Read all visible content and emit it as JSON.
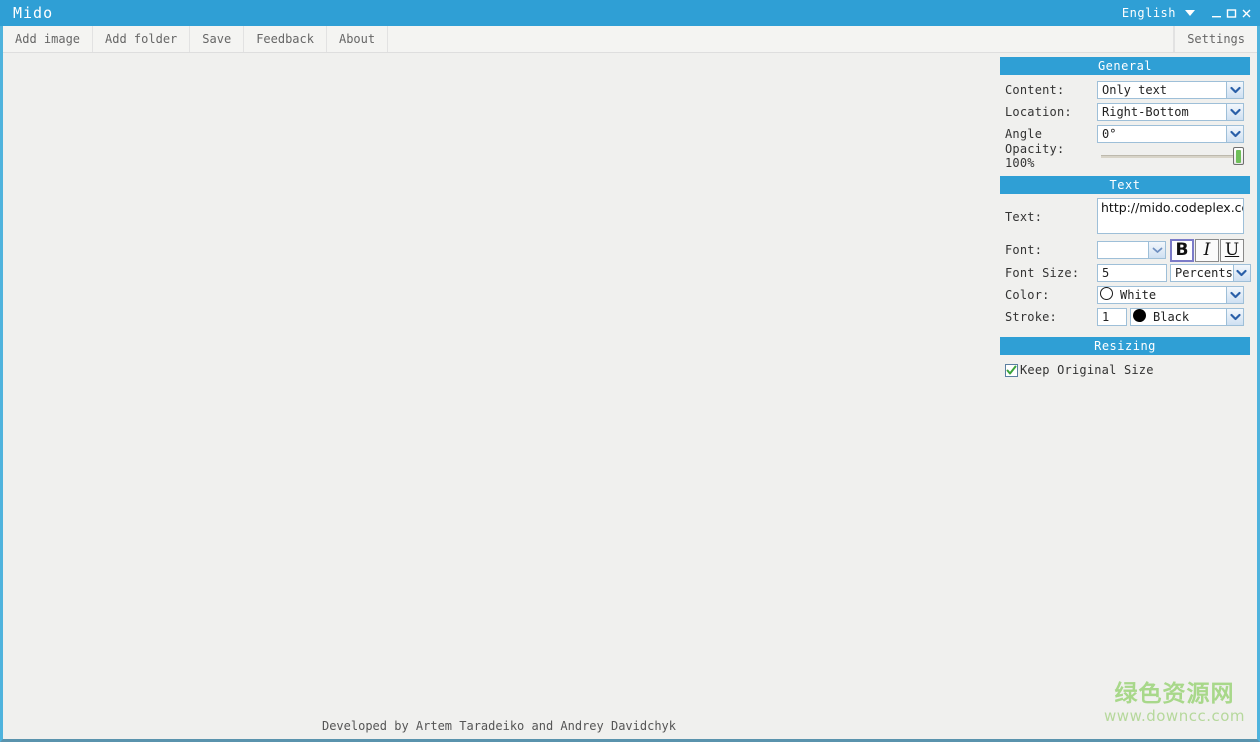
{
  "window": {
    "title": "Mido",
    "language": "English",
    "controls": {
      "minimize": "minimize-button",
      "maximize": "maximize-button",
      "close": "close-button"
    }
  },
  "menubar": {
    "items": [
      {
        "label": "Add image"
      },
      {
        "label": "Add folder"
      },
      {
        "label": "Save"
      },
      {
        "label": "Feedback"
      },
      {
        "label": "About"
      }
    ],
    "settings_label": "Settings"
  },
  "canvas": {
    "credit": "Developed by Artem Taradeiko and Andrey Davidchyk",
    "watermark_cn": "绿色资源网",
    "watermark_en": "www.downcc.com"
  },
  "panels": {
    "general": {
      "header": "General",
      "content_label": "Content:",
      "content_value": "Only text",
      "location_label": "Location:",
      "location_value": "Right-Bottom",
      "angle_label": "Angle",
      "angle_value": "0°",
      "opacity_label": "Opacity: 100%"
    },
    "text": {
      "header": "Text",
      "text_label": "Text:",
      "text_value": "http://mido.codeplex.com",
      "font_label": "Font:",
      "font_value": "",
      "bold_label": "B",
      "italic_label": "I",
      "underline_label": "U",
      "font_size_label": "Font Size:",
      "font_size_value": "5",
      "font_size_units": "Percents",
      "color_label": "Color:",
      "color_value": "White",
      "stroke_label": "Stroke:",
      "stroke_width": "1",
      "stroke_color": "Black"
    },
    "resizing": {
      "header": "Resizing",
      "keep_original_label": "Keep Original Size"
    }
  },
  "colors": {
    "accent": "#2f9fd5",
    "border": "#4fb3dd",
    "canvas": "#f0f0ee",
    "watermark_green": "#a8d88a"
  }
}
